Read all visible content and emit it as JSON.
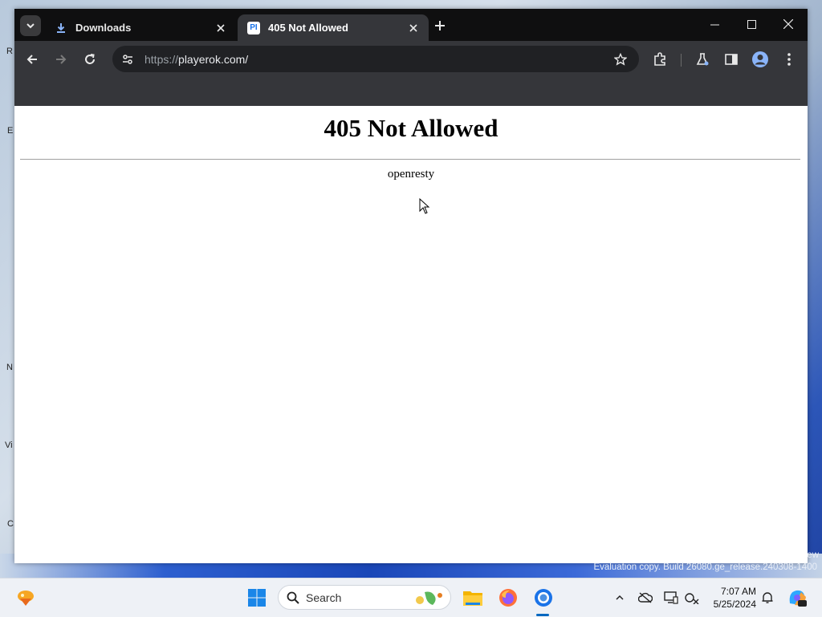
{
  "desktop": {
    "icon_labels": [
      "R",
      "E",
      "N",
      "Vi",
      "C"
    ],
    "watermark_text": "Evaluation copy. Build 26080.ge_release.240308-1400",
    "watermark_prefix": "ew"
  },
  "browser": {
    "tabs": [
      {
        "title": "Downloads",
        "active": false,
        "favicon": "download-icon"
      },
      {
        "title": "405 Not Allowed",
        "active": true,
        "favicon": "playerok-favicon",
        "favicon_text": "PI"
      }
    ],
    "address_bar": {
      "scheme": "https://",
      "host": "playerok.com/"
    },
    "colors": {
      "frame": "#0f0f10",
      "toolbar": "#35363a",
      "omnibox": "#202124",
      "accent": "#1a73e8"
    }
  },
  "page": {
    "heading": "405 Not Allowed",
    "server": "openresty"
  },
  "taskbar": {
    "search_placeholder": "Search",
    "clock_time": "7:07 AM",
    "clock_date": "5/25/2024",
    "pinned": [
      "widgets-icon",
      "start-icon",
      "search",
      "file-explorer-icon",
      "firefox-icon",
      "chrome-icon"
    ],
    "tray": [
      "chevron-up-icon",
      "onedrive-icon",
      "display-icon",
      "network-icon",
      "bell-icon",
      "copilot-icon"
    ]
  }
}
